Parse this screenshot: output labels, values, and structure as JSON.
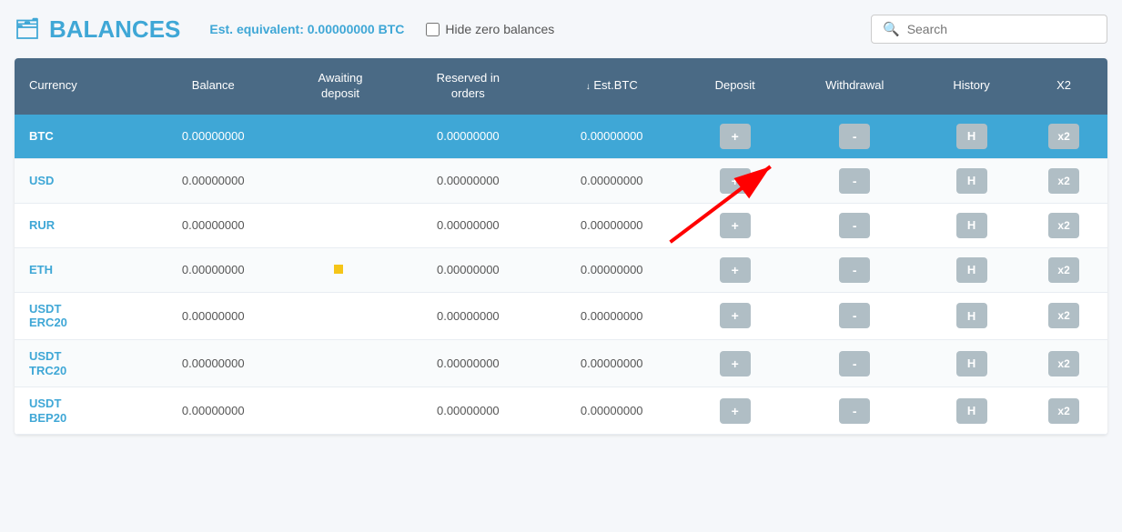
{
  "header": {
    "title": "BALANCES",
    "est_label": "Est. equivalent:",
    "est_value": "0.00000000 BTC",
    "hide_zero_label": "Hide zero balances",
    "search_placeholder": "Search"
  },
  "table": {
    "columns": [
      "Currency",
      "Balance",
      "Awaiting deposit",
      "Reserved in orders",
      "Est.BTC",
      "Deposit",
      "Withdrawal",
      "History",
      "X2"
    ],
    "rows": [
      {
        "currency": "BTC",
        "balance": "0.00000000",
        "awaiting": "",
        "reserved": "0.00000000",
        "est_btc": "0.00000000",
        "active": true
      },
      {
        "currency": "USD",
        "balance": "0.00000000",
        "awaiting": "",
        "reserved": "0.00000000",
        "est_btc": "0.00000000",
        "active": false
      },
      {
        "currency": "RUR",
        "balance": "0.00000000",
        "awaiting": "",
        "reserved": "0.00000000",
        "est_btc": "0.00000000",
        "active": false
      },
      {
        "currency": "ETH",
        "balance": "0.00000000",
        "awaiting": "",
        "reserved": "0.00000000",
        "est_btc": "0.00000000",
        "active": false
      },
      {
        "currency": "USDT\nERC20",
        "balance": "0.00000000",
        "awaiting": "",
        "reserved": "0.00000000",
        "est_btc": "0.00000000",
        "active": false
      },
      {
        "currency": "USDT\nTRC20",
        "balance": "0.00000000",
        "awaiting": "",
        "reserved": "0.00000000",
        "est_btc": "0.00000000",
        "active": false
      },
      {
        "currency": "USDT\nBEP20",
        "balance": "0.00000000",
        "awaiting": "",
        "reserved": "0.00000000",
        "est_btc": "0.00000000",
        "active": false
      }
    ],
    "btn_plus": "+",
    "btn_minus": "-",
    "btn_h": "H",
    "btn_x2": "x2"
  }
}
